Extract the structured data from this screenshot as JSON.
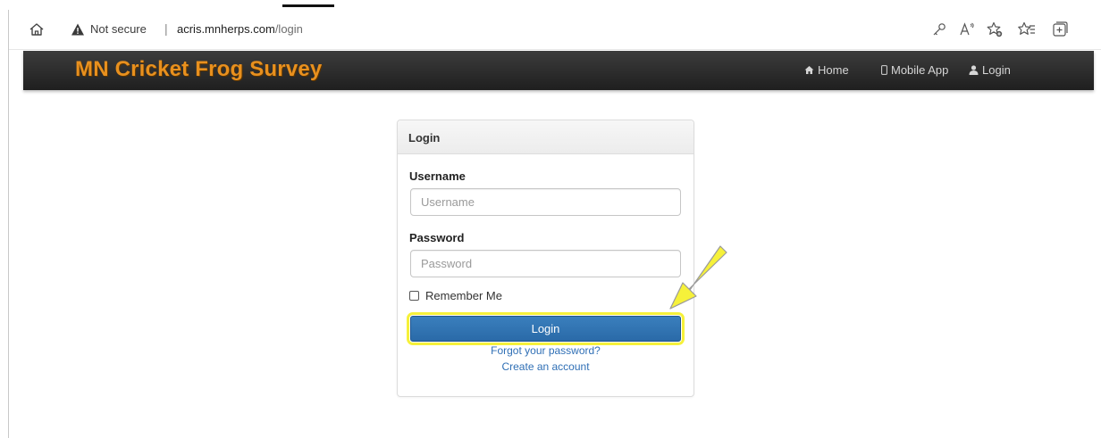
{
  "browser": {
    "security_status": "Not secure",
    "separator": "|",
    "url_host": "acris.mnherps.com",
    "url_path": "/login",
    "icons": [
      "home-icon",
      "warning-icon",
      "key-icon",
      "read-aloud-icon",
      "add-favorite-icon",
      "favorites-icon",
      "collections-icon"
    ]
  },
  "navbar": {
    "brand": "MN Cricket Frog Survey",
    "links": [
      {
        "label": "Home",
        "icon": "home-icon"
      },
      {
        "label": "Mobile App",
        "icon": "mobile-icon"
      },
      {
        "label": "Login",
        "icon": "user-icon"
      }
    ]
  },
  "login_panel": {
    "title": "Login",
    "username_label": "Username",
    "username_placeholder": "Username",
    "username_value": "",
    "password_label": "Password",
    "password_placeholder": "Password",
    "password_value": "",
    "remember_label": "Remember Me",
    "remember_checked": false,
    "submit_label": "Login",
    "forgot_link": "Forgot your password?",
    "create_link": "Create an account"
  },
  "annotation": {
    "type": "arrow-pointer",
    "target": "login-button",
    "color": "#f6f13a",
    "highlight_color": "#f6f13a"
  },
  "colors": {
    "brand": "#e8901e",
    "navbar": "#2b2b2b",
    "primary_button": "#2f72b0",
    "link": "#2f6fb5"
  }
}
